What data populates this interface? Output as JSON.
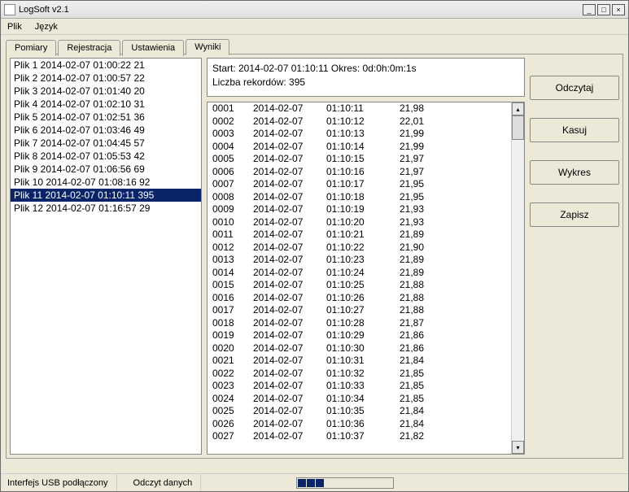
{
  "window": {
    "title": "LogSoft v2.1"
  },
  "menu": {
    "items": [
      "Plik",
      "Język"
    ]
  },
  "tabs": {
    "items": [
      {
        "label": "Pomiary"
      },
      {
        "label": "Rejestracja"
      },
      {
        "label": "Ustawienia"
      },
      {
        "label": "Wyniki",
        "active": true
      }
    ]
  },
  "file_list": {
    "items": [
      {
        "text": "Plik 1  2014-02-07 01:00:22  21"
      },
      {
        "text": "Plik 2  2014-02-07 01:00:57  22"
      },
      {
        "text": "Plik 3  2014-02-07 01:01:40  20"
      },
      {
        "text": "Plik 4  2014-02-07 01:02:10  31"
      },
      {
        "text": "Plik 5  2014-02-07 01:02:51  36"
      },
      {
        "text": "Plik 6  2014-02-07 01:03:46  49"
      },
      {
        "text": "Plik 7  2014-02-07 01:04:45  57"
      },
      {
        "text": "Plik 8  2014-02-07 01:05:53  42"
      },
      {
        "text": "Plik 9  2014-02-07 01:06:56  69"
      },
      {
        "text": "Plik 10  2014-02-07 01:08:16  92"
      },
      {
        "text": "Plik 11  2014-02-07 01:10:11  395",
        "selected": true
      },
      {
        "text": "Plik 12  2014-02-07 01:16:57  29"
      }
    ]
  },
  "summary": {
    "line1": "Start: 2014-02-07 01:10:11  Okres: 0d:0h:0m:1s",
    "line2": "Liczba rekordów: 395"
  },
  "data_rows": [
    {
      "idx": "0001",
      "date": "2014-02-07",
      "time": "01:10:11",
      "val": "21,98"
    },
    {
      "idx": "0002",
      "date": "2014-02-07",
      "time": "01:10:12",
      "val": "22,01"
    },
    {
      "idx": "0003",
      "date": "2014-02-07",
      "time": "01:10:13",
      "val": "21,99"
    },
    {
      "idx": "0004",
      "date": "2014-02-07",
      "time": "01:10:14",
      "val": "21,99"
    },
    {
      "idx": "0005",
      "date": "2014-02-07",
      "time": "01:10:15",
      "val": "21,97"
    },
    {
      "idx": "0006",
      "date": "2014-02-07",
      "time": "01:10:16",
      "val": "21,97"
    },
    {
      "idx": "0007",
      "date": "2014-02-07",
      "time": "01:10:17",
      "val": "21,95"
    },
    {
      "idx": "0008",
      "date": "2014-02-07",
      "time": "01:10:18",
      "val": "21,95"
    },
    {
      "idx": "0009",
      "date": "2014-02-07",
      "time": "01:10:19",
      "val": "21,93"
    },
    {
      "idx": "0010",
      "date": "2014-02-07",
      "time": "01:10:20",
      "val": "21,93"
    },
    {
      "idx": "0011",
      "date": "2014-02-07",
      "time": "01:10:21",
      "val": "21,89"
    },
    {
      "idx": "0012",
      "date": "2014-02-07",
      "time": "01:10:22",
      "val": "21,90"
    },
    {
      "idx": "0013",
      "date": "2014-02-07",
      "time": "01:10:23",
      "val": "21,89"
    },
    {
      "idx": "0014",
      "date": "2014-02-07",
      "time": "01:10:24",
      "val": "21,89"
    },
    {
      "idx": "0015",
      "date": "2014-02-07",
      "time": "01:10:25",
      "val": "21,88"
    },
    {
      "idx": "0016",
      "date": "2014-02-07",
      "time": "01:10:26",
      "val": "21,88"
    },
    {
      "idx": "0017",
      "date": "2014-02-07",
      "time": "01:10:27",
      "val": "21,88"
    },
    {
      "idx": "0018",
      "date": "2014-02-07",
      "time": "01:10:28",
      "val": "21,87"
    },
    {
      "idx": "0019",
      "date": "2014-02-07",
      "time": "01:10:29",
      "val": "21,86"
    },
    {
      "idx": "0020",
      "date": "2014-02-07",
      "time": "01:10:30",
      "val": "21,86"
    },
    {
      "idx": "0021",
      "date": "2014-02-07",
      "time": "01:10:31",
      "val": "21,84"
    },
    {
      "idx": "0022",
      "date": "2014-02-07",
      "time": "01:10:32",
      "val": "21,85"
    },
    {
      "idx": "0023",
      "date": "2014-02-07",
      "time": "01:10:33",
      "val": "21,85"
    },
    {
      "idx": "0024",
      "date": "2014-02-07",
      "time": "01:10:34",
      "val": "21,85"
    },
    {
      "idx": "0025",
      "date": "2014-02-07",
      "time": "01:10:35",
      "val": "21,84"
    },
    {
      "idx": "0026",
      "date": "2014-02-07",
      "time": "01:10:36",
      "val": "21,84"
    },
    {
      "idx": "0027",
      "date": "2014-02-07",
      "time": "01:10:37",
      "val": "21,82"
    }
  ],
  "buttons": {
    "read": "Odczytaj",
    "delete": "Kasuj",
    "chart": "Wykres",
    "save": "Zapisz"
  },
  "status": {
    "cell1": "Interfejs USB podłączony",
    "cell2": "Odczyt danych"
  }
}
